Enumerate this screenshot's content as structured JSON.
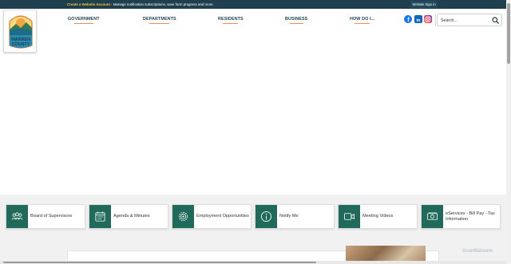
{
  "topbar": {
    "highlight": "Create a Website Account",
    "message": " - Manage notification subscriptions, save form progress and more.",
    "signin_label": "Website Sign In"
  },
  "logo": {
    "line1": "WARREN",
    "line2": "COUNTY"
  },
  "nav": {
    "items": [
      {
        "label": "GOVERNMENT"
      },
      {
        "label": "DEPARTMENTS"
      },
      {
        "label": "RESIDENTS"
      },
      {
        "label": "BUSINESS"
      },
      {
        "label": "HOW DO I..."
      }
    ]
  },
  "social": {
    "facebook": "f",
    "linkedin": "in"
  },
  "search": {
    "placeholder": "Search..."
  },
  "quick_links": [
    {
      "label": "Board of Supervisors",
      "icon": "people-icon"
    },
    {
      "label": "Agenda & Minutes",
      "icon": "calendar-icon"
    },
    {
      "label": "Employment Opportunities",
      "icon": "gear-icon"
    },
    {
      "label": "Notify Me",
      "icon": "info-icon"
    },
    {
      "label": "Meeting Videos",
      "icon": "video-icon"
    },
    {
      "label": "eServices - Bill Pay - Tax Information",
      "icon": "money-icon"
    }
  ],
  "watermark": "ScanMalware",
  "colors": {
    "brand_dark": "#1f3f4f",
    "accent_green": "#1f6a5a",
    "accent_orange": "#e0742b"
  }
}
